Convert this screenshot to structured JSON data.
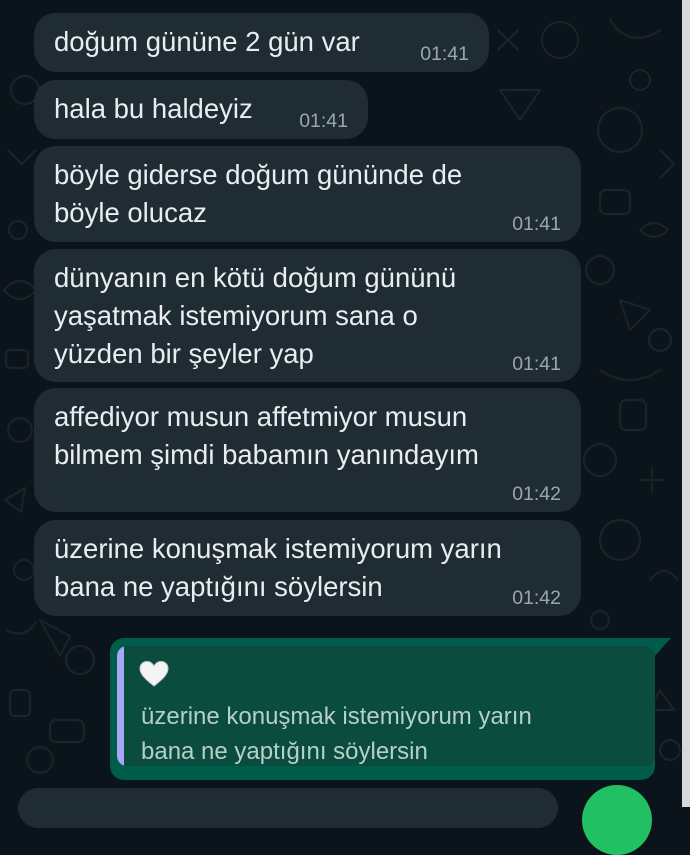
{
  "messages": [
    {
      "text": "doğum gününe 2 gün var",
      "time": "01:41"
    },
    {
      "text": "hala bu haldeyiz",
      "time": "01:41"
    },
    {
      "text": "böyle giderse doğum gününde de\nböyle olucaz",
      "time": "01:41"
    },
    {
      "text": "dünyanın en kötü doğum gününü\nyaşatmak istemiyorum sana o\nyüzden bir şeyler yap",
      "time": "01:41"
    },
    {
      "text": "affediyor musun affetmiyor musun\nbilmem şimdi babamın yanındayım",
      "time": "01:42"
    },
    {
      "text": "üzerine konuşmak istemiyorum yarın\nbana ne yaptığını söylersin",
      "time": "01:42"
    }
  ],
  "reply": {
    "icon": "white-heart-icon",
    "quoted_text": "üzerine konuşmak istemiyorum yarın\nbana ne yaptığını söylersin"
  },
  "colors": {
    "background": "#0b141a",
    "incoming_bubble": "#202c33",
    "outgoing_bubble": "#005c4b",
    "quote_bar": "#a5a6f6",
    "fab": "#21c063"
  }
}
